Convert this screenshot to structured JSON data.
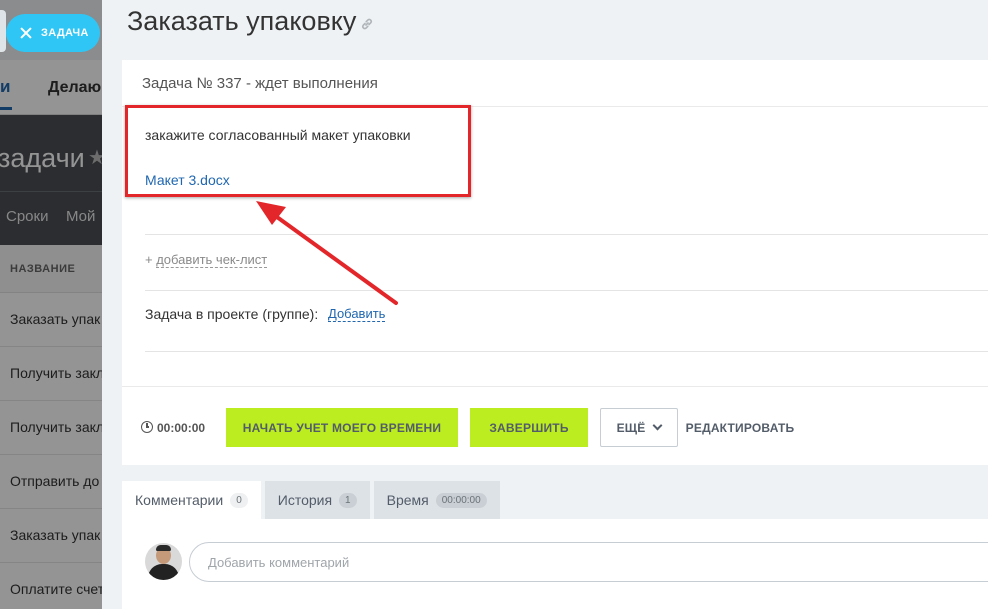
{
  "background_list": {
    "tabs": [
      "и",
      "Делаю"
    ],
    "title": "задачи",
    "filters": [
      "Сроки",
      "Мой"
    ],
    "column_header": "НАЗВАНИЕ",
    "rows": [
      "Заказать упак",
      "Получить закл",
      "Получить закл",
      "Отправить до",
      "Заказать упак",
      "Оплатите счет"
    ]
  },
  "close_button": {
    "label": "ЗАДАЧА"
  },
  "task": {
    "title": "Заказать упаковку",
    "header": "Задача № 337 - ждет выполнения",
    "description": "закажите согласованный макет упаковки",
    "attachment": "Макет 3.docx",
    "checklist_link": "добавить чек-лист",
    "checklist_plus": "+",
    "project_label": "Задача в проекте (группе):",
    "project_add": "Добавить"
  },
  "footer": {
    "timer": "00:00:00",
    "start_button": "НАЧАТЬ УЧЕТ МОЕГО ВРЕМЕНИ",
    "finish_button": "ЗАВЕРШИТЬ",
    "more_button": "ЕЩЁ",
    "edit_button": "РЕДАКТИРОВАТЬ"
  },
  "tabs": [
    {
      "label": "Комментарии",
      "count": "0"
    },
    {
      "label": "История",
      "count": "1"
    },
    {
      "label": "Время",
      "count": "00:00:00"
    }
  ],
  "comment": {
    "placeholder": "Добавить комментарий"
  },
  "colors": {
    "accent_green": "#bbed21",
    "link_blue": "#2067b0",
    "highlight_red": "#e3262a",
    "close_pill": "#2fc6f6"
  }
}
